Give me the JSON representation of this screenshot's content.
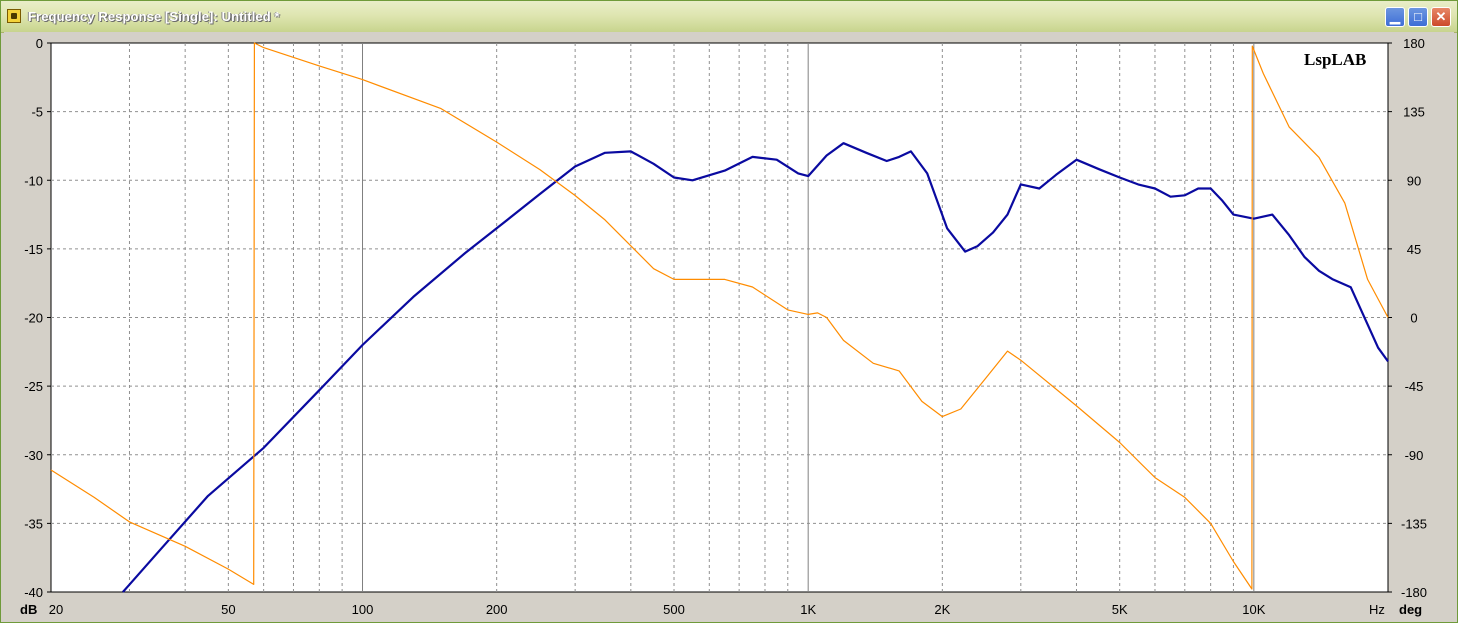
{
  "window": {
    "title": "Frequency Response [Single]: Untitled *",
    "buttons": [
      "minimize",
      "maximize",
      "close"
    ]
  },
  "chart_data": {
    "type": "line",
    "title": "",
    "watermark": "LspLAB",
    "xscale": "log",
    "xlim": [
      20,
      20000
    ],
    "x_tick_labels": [
      "20",
      "50",
      "100",
      "200",
      "500",
      "1K",
      "2K",
      "5K",
      "10K"
    ],
    "x_tick_values": [
      20,
      50,
      100,
      200,
      500,
      1000,
      2000,
      5000,
      10000
    ],
    "x_unit": "Hz",
    "y_left": {
      "label": "dB",
      "color": "#0000a8",
      "lim": [
        -40,
        0
      ],
      "ticks": [
        0,
        -5,
        -10,
        -15,
        -20,
        -25,
        -30,
        -35,
        -40
      ]
    },
    "y_right": {
      "label": "deg",
      "color": "#ff8c00",
      "lim": [
        -180,
        180
      ],
      "ticks": [
        180,
        135,
        90,
        45,
        0,
        -45,
        -90,
        -135,
        -180
      ]
    },
    "grid": true,
    "series": [
      {
        "axis": "left",
        "color": "#0a0aa0",
        "points": [
          [
            29,
            -40.0
          ],
          [
            35,
            -37.0
          ],
          [
            45,
            -33.0
          ],
          [
            60,
            -29.5
          ],
          [
            80,
            -25.3
          ],
          [
            100,
            -22.0
          ],
          [
            130,
            -18.5
          ],
          [
            170,
            -15.3
          ],
          [
            200,
            -13.5
          ],
          [
            250,
            -11.0
          ],
          [
            300,
            -9.0
          ],
          [
            350,
            -8.0
          ],
          [
            400,
            -7.9
          ],
          [
            450,
            -8.8
          ],
          [
            500,
            -9.8
          ],
          [
            550,
            -10.0
          ],
          [
            650,
            -9.3
          ],
          [
            750,
            -8.3
          ],
          [
            850,
            -8.5
          ],
          [
            950,
            -9.5
          ],
          [
            1000,
            -9.7
          ],
          [
            1100,
            -8.2
          ],
          [
            1200,
            -7.3
          ],
          [
            1350,
            -8.0
          ],
          [
            1500,
            -8.6
          ],
          [
            1600,
            -8.3
          ],
          [
            1700,
            -7.9
          ],
          [
            1850,
            -9.5
          ],
          [
            2050,
            -13.5
          ],
          [
            2250,
            -15.2
          ],
          [
            2400,
            -14.8
          ],
          [
            2600,
            -13.8
          ],
          [
            2800,
            -12.5
          ],
          [
            3000,
            -10.3
          ],
          [
            3300,
            -10.6
          ],
          [
            3600,
            -9.6
          ],
          [
            4000,
            -8.5
          ],
          [
            4500,
            -9.2
          ],
          [
            5000,
            -9.8
          ],
          [
            5500,
            -10.3
          ],
          [
            6000,
            -10.6
          ],
          [
            6500,
            -11.2
          ],
          [
            7000,
            -11.1
          ],
          [
            7500,
            -10.6
          ],
          [
            8000,
            -10.6
          ],
          [
            8500,
            -11.5
          ],
          [
            9000,
            -12.5
          ],
          [
            10000,
            -12.8
          ],
          [
            11000,
            -12.5
          ],
          [
            12000,
            -14.0
          ],
          [
            13000,
            -15.6
          ],
          [
            14000,
            -16.6
          ],
          [
            15000,
            -17.2
          ],
          [
            16500,
            -17.8
          ],
          [
            18000,
            -20.5
          ],
          [
            19000,
            -22.2
          ],
          [
            20000,
            -23.2
          ]
        ]
      },
      {
        "axis": "right",
        "color": "#ff8c00",
        "points": [
          [
            20,
            -100
          ],
          [
            25,
            -118
          ],
          [
            30,
            -134
          ],
          [
            40,
            -150
          ],
          [
            50,
            -165
          ],
          [
            57,
            -175
          ],
          [
            57.2,
            180
          ],
          [
            60,
            177
          ],
          [
            80,
            165
          ],
          [
            100,
            156
          ],
          [
            150,
            137
          ],
          [
            200,
            115
          ],
          [
            250,
            97
          ],
          [
            300,
            80
          ],
          [
            350,
            64
          ],
          [
            400,
            47
          ],
          [
            450,
            32
          ],
          [
            500,
            25
          ],
          [
            550,
            25
          ],
          [
            650,
            25
          ],
          [
            750,
            20
          ],
          [
            900,
            5
          ],
          [
            1000,
            2
          ],
          [
            1050,
            3
          ],
          [
            1100,
            0
          ],
          [
            1200,
            -15
          ],
          [
            1400,
            -30
          ],
          [
            1600,
            -35
          ],
          [
            1800,
            -55
          ],
          [
            2000,
            -65
          ],
          [
            2200,
            -60
          ],
          [
            2500,
            -40
          ],
          [
            2800,
            -22
          ],
          [
            3000,
            -28
          ],
          [
            3500,
            -44
          ],
          [
            4000,
            -58
          ],
          [
            5000,
            -82
          ],
          [
            6000,
            -105
          ],
          [
            7000,
            -118
          ],
          [
            8000,
            -135
          ],
          [
            9000,
            -160
          ],
          [
            9900,
            -178
          ],
          [
            9920,
            178
          ],
          [
            10500,
            160
          ],
          [
            12000,
            125
          ],
          [
            14000,
            105
          ],
          [
            16000,
            75
          ],
          [
            18000,
            25
          ],
          [
            20000,
            0
          ]
        ]
      }
    ]
  }
}
